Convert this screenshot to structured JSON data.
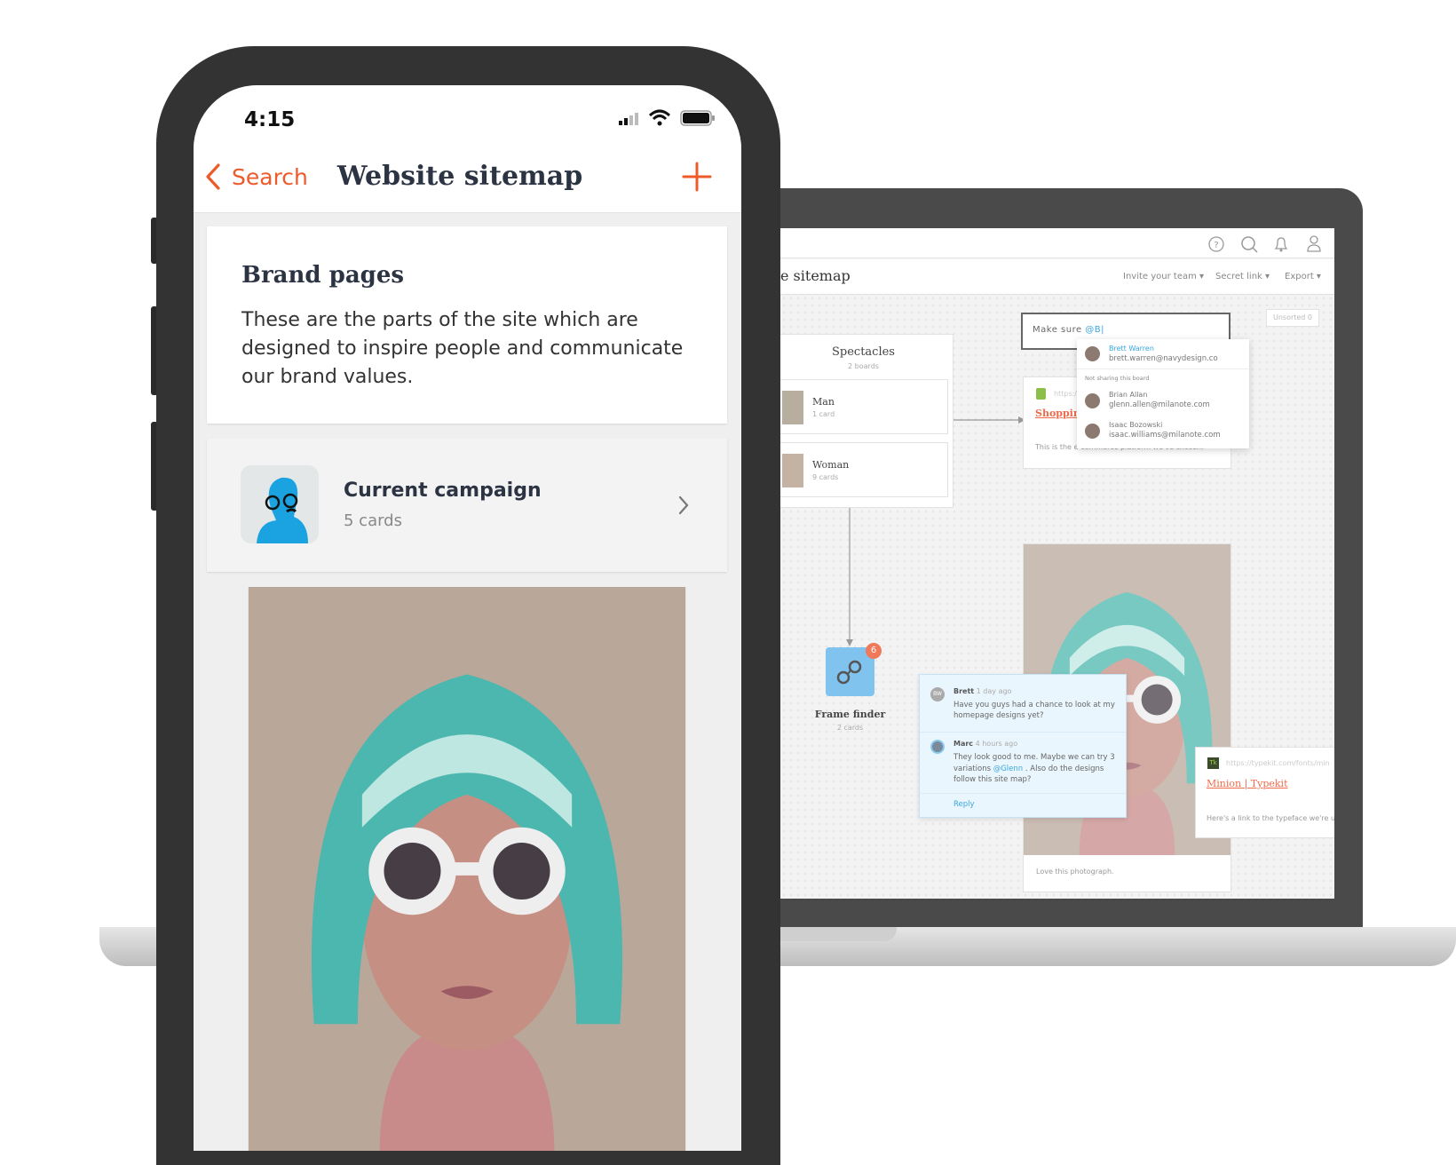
{
  "laptop": {
    "topbar_icons": [
      "help-icon",
      "search-icon",
      "bell-icon",
      "user-icon"
    ],
    "title": "e sitemap",
    "menu": [
      {
        "label": "Invite your team"
      },
      {
        "label": "Secret link"
      },
      {
        "label": "Export"
      }
    ],
    "unsorted": "Unsorted 0",
    "board": {
      "title": "Spectacles",
      "count": "2 boards",
      "items": [
        {
          "name": "Man",
          "count": "1 card"
        },
        {
          "name": "Woman",
          "count": "9 cards"
        }
      ]
    },
    "input": {
      "text": "Make sure ",
      "mention": "@B"
    },
    "mention_dropdown": {
      "top": {
        "name": "Brett Warren",
        "email": "brett.warren@navydesign.co"
      },
      "section": "Not sharing this board",
      "others": [
        {
          "name": "Brian Allan",
          "email": "glenn.allen@milanote.com"
        },
        {
          "name": "Isaac Bozowski",
          "email": "isaac.williams@milanote.com"
        }
      ]
    },
    "link_card": {
      "url": "https://",
      "title": "Shopping",
      "description": "This is the e-commerce platform we've chosen."
    },
    "frame_finder": {
      "title": "Frame finder",
      "count": "2 cards",
      "badge": "6"
    },
    "comments": [
      {
        "initials": "BW",
        "author": "Brett",
        "time": "1 day ago",
        "text": "Have you guys had a chance to look at my homepage designs yet?"
      },
      {
        "author": "Marc",
        "time": "4 hours ago",
        "text_a": "They look good to me. Maybe we can try 3 variations ",
        "mention": "@Glenn",
        "text_b": " . Also do the designs follow this site map?"
      }
    ],
    "reply": "Reply",
    "photo_caption": "Love this photograph.",
    "typekit": {
      "logo": "Tk",
      "url": "https://typekit.com/fonts/min",
      "title": "Minion | Typekit",
      "description": "Here's a link to the typeface we're u"
    },
    "colors": {
      "accent": "#ef6a4b",
      "link": "#3aa6e0",
      "comment_bg": "#eaf6fd"
    }
  },
  "phone": {
    "time": "4:15",
    "back_label": "Search",
    "title": "Website sitemap",
    "add_icon": "plus-icon",
    "brand": {
      "title": "Brand pages",
      "text": "These are the parts of the site which are designed to inspire people and communicate our brand values."
    },
    "campaign": {
      "title": "Current campaign",
      "count": "5 cards"
    },
    "colors": {
      "accent": "#ef5a2a",
      "title": "#2c3444"
    }
  }
}
